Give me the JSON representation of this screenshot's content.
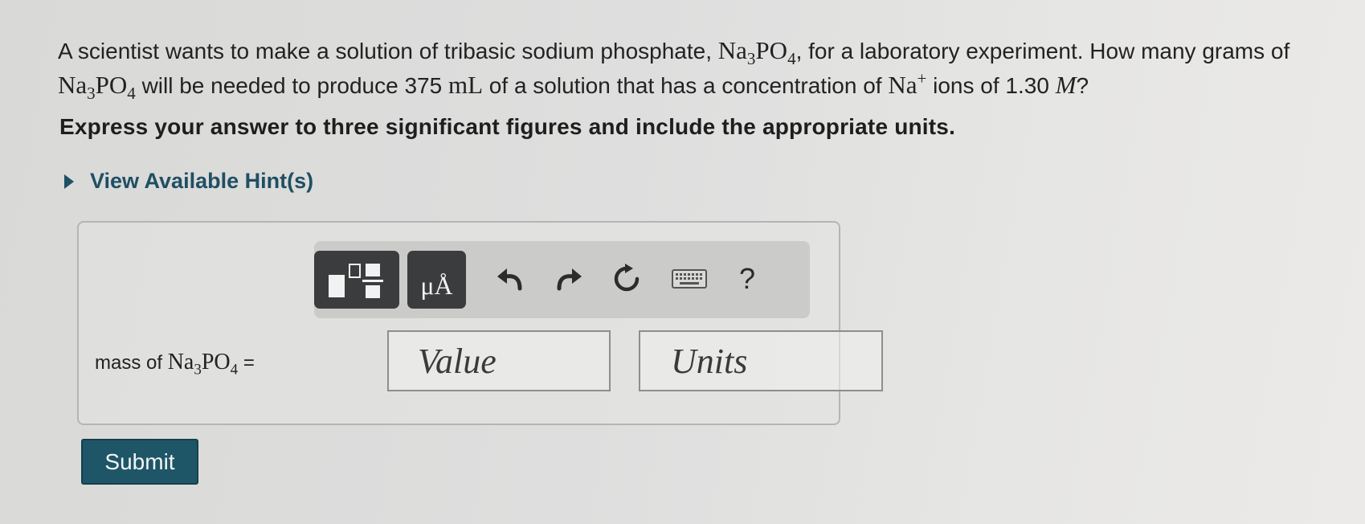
{
  "question": {
    "p1": "A scientist wants to make a solution of tribasic sodium phosphate, ",
    "p2": ", for a laboratory experiment. How many grams of ",
    "p3": " will be needed to produce 375 ",
    "p4": " of a solution that has a concentration of ",
    "p5": " ions of 1.30 ",
    "p6": "?",
    "na": "Na",
    "po": "PO",
    "sub3": "3",
    "sub4": "4",
    "ml": "mL",
    "plus": "+",
    "molar": "M"
  },
  "instruction": "Express your answer to three significant figures and include the appropriate units.",
  "hint": {
    "label": "View Available Hint(s)"
  },
  "toolbar": {
    "units_label": "μÅ",
    "undo_icon": "undo-arrow-icon",
    "redo_icon": "redo-arrow-icon",
    "reset_icon": "reset-icon",
    "keyboard_icon": "keyboard-icon",
    "help_label": "?"
  },
  "answer": {
    "label_prefix": "mass of ",
    "label_suffix": " =",
    "value_placeholder": "Value",
    "units_placeholder": "Units"
  },
  "submit_label": "Submit",
  "colors": {
    "accent": "#1e5668",
    "hint": "#1f4f63",
    "toolbar_button": "#3b3c3d"
  }
}
